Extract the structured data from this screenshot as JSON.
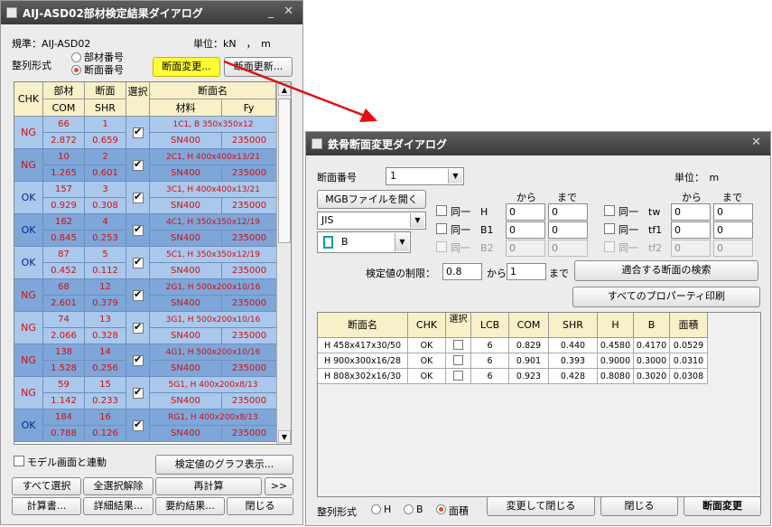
{
  "left_window": {
    "title": "AIJ-ASD02部材検定結果ダイアログ",
    "standard_label": "規準：AIJ-ASD02",
    "unit_label": "単位：kN　，　m",
    "sort_label": "整列形式",
    "sort_options": [
      "部材番号",
      "断面番号"
    ],
    "section_change_button": "断面変更...",
    "section_update_button": "断面更新...",
    "headers": {
      "chk": "CHK",
      "member": "部材",
      "section": "断面",
      "select": "選択",
      "section_name": "断面名",
      "com": "COM",
      "shr": "SHR",
      "material": "材料",
      "fy": "Fy"
    },
    "rows": [
      {
        "chk": "NG",
        "member": "66",
        "section": "1",
        "com": "2.872",
        "shr": "0.659",
        "name": "1C1, B 350x350x12",
        "material": "SN400",
        "fy": "235000"
      },
      {
        "chk": "NG",
        "member": "10",
        "section": "2",
        "com": "1.265",
        "shr": "0.601",
        "name": "2C1, H 400x400x13/21",
        "material": "SN400",
        "fy": "235000"
      },
      {
        "chk": "OK",
        "member": "157",
        "section": "3",
        "com": "0.929",
        "shr": "0.308",
        "name": "3C1, H 400x400x13/21",
        "material": "SN400",
        "fy": "235000"
      },
      {
        "chk": "OK",
        "member": "162",
        "section": "4",
        "com": "0.845",
        "shr": "0.253",
        "name": "4C1, H 350x350x12/19",
        "material": "SN400",
        "fy": "235000"
      },
      {
        "chk": "OK",
        "member": "87",
        "section": "5",
        "com": "0.452",
        "shr": "0.112",
        "name": "5C1, H 350x350x12/19",
        "material": "SN400",
        "fy": "235000"
      },
      {
        "chk": "NG",
        "member": "68",
        "section": "12",
        "com": "2.601",
        "shr": "0.379",
        "name": "2G1, H 500x200x10/16",
        "material": "SN400",
        "fy": "235000"
      },
      {
        "chk": "NG",
        "member": "74",
        "section": "13",
        "com": "2.066",
        "shr": "0.328",
        "name": "3G1, H 500x200x10/16",
        "material": "SN400",
        "fy": "235000"
      },
      {
        "chk": "NG",
        "member": "138",
        "section": "14",
        "com": "1.528",
        "shr": "0.256",
        "name": "4G1, H 500x200x10/16",
        "material": "SN400",
        "fy": "235000"
      },
      {
        "chk": "NG",
        "member": "59",
        "section": "15",
        "com": "1.142",
        "shr": "0.233",
        "name": "5G1, H 400x200x8/13",
        "material": "SN400",
        "fy": "235000"
      },
      {
        "chk": "OK",
        "member": "184",
        "section": "16",
        "com": "0.788",
        "shr": "0.126",
        "name": "RG1, H 400x200x8/13",
        "material": "SN400",
        "fy": "235000"
      }
    ],
    "model_link_label": "モデル画面と連動",
    "graph_button": "検定値のグラフ表示...",
    "buttons_row1": [
      "すべて選択",
      "全選択解除",
      "再計算",
      ">>"
    ],
    "buttons_row2": [
      "計算書...",
      "詳細結果...",
      "要約結果...",
      "閉じる"
    ]
  },
  "right_window": {
    "title": "鉄骨断面変更ダイアログ",
    "section_number_label": "断面番号",
    "section_number_value": "1",
    "unit_label": "単位：　m",
    "mgb_button": "MGBファイルを開く",
    "standard_combo": "JIS",
    "shape_combo": "B",
    "from_label": "から",
    "to_label": "まで",
    "same_labels_left": [
      "同一　H",
      "同一　B1",
      "同一　B2"
    ],
    "same_labels_right": [
      "同一　tw",
      "同一　tf1",
      "同一　tf2"
    ],
    "inputs_left": [
      [
        "0",
        "0"
      ],
      [
        "0",
        "0"
      ],
      [
        "0",
        "0"
      ]
    ],
    "inputs_right": [
      [
        "0",
        "0"
      ],
      [
        "0",
        "0"
      ],
      [
        "0",
        "0"
      ]
    ],
    "limit_label": "検定値の制限：",
    "limit_from": "0.8",
    "limit_to": "1",
    "search_button": "適合する断面の検索",
    "print_button": "すべてのプロパーティ印刷",
    "headers": [
      "断面名",
      "CHK",
      "選択",
      "LCB",
      "COM",
      "SHR",
      "H",
      "B",
      "面積"
    ],
    "rows": [
      {
        "name": "H 458x417x30/50",
        "chk": "OK",
        "lcb": "6",
        "com": "0.829",
        "shr": "0.440",
        "h": "0.4580",
        "b": "0.4170",
        "area": "0.0529"
      },
      {
        "name": "H 900x300x16/28",
        "chk": "OK",
        "lcb": "6",
        "com": "0.901",
        "shr": "0.393",
        "h": "0.9000",
        "b": "0.3000",
        "area": "0.0310"
      },
      {
        "name": "H 808x302x16/30",
        "chk": "OK",
        "lcb": "6",
        "com": "0.923",
        "shr": "0.428",
        "h": "0.8080",
        "b": "0.3020",
        "area": "0.0308"
      }
    ],
    "sort_label": "整列形式",
    "sort_options": [
      "H",
      "B",
      "面積"
    ],
    "change_close_button": "変更して閉じる",
    "close_button": "閉じる",
    "section_change_button": "断面変更"
  },
  "colors": {
    "row_light": "#a9c8ec",
    "row_dark": "#7ea6d9",
    "ng_text": "#d01010",
    "ok_text": "#0a2a8a",
    "header_bg": "#f7f0c8",
    "arrow": "#e01010"
  }
}
